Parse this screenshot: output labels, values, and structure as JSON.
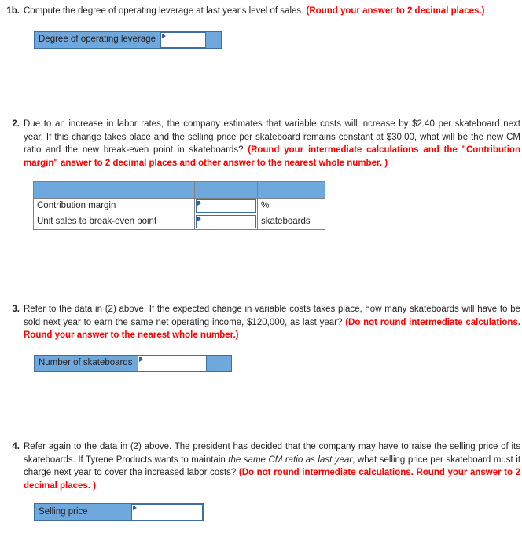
{
  "page": {
    "background_color": "#ffffff",
    "accent_blue": "#6fa8dc",
    "input_border_color": "#3d6fa5",
    "instruction_red": "#ff0000"
  },
  "questions": [
    {
      "number": "1b.",
      "text_before_red": "Compute the degree of operating leverage at last year's level of sales. ",
      "red_instruction": "(Round your answer to 2 decimal places.)"
    },
    {
      "number": "2.",
      "text_before_red": "Due to an increase in labor rates, the company estimates that variable costs will increase by $2.40 per skateboard next year. If this change takes place and the selling price per skateboard remains constant at $30.00, what will be the new CM ratio and the new break-even point in skateboards? ",
      "red_instruction": "(Round  your intermediate calculations and the \"Contribution margin\" answer to 2 decimal places and other answer to the nearest whole number. )"
    },
    {
      "number": "3.",
      "text_before_red": "Refer to the data in (2) above. If the expected change in variable costs takes place, how many skateboards will have to be sold next year to earn the same net operating income, $120,000, as last year? ",
      "red_instruction": "(Do not round intermediate calculations. Round your answer to the nearest whole number.)"
    },
    {
      "number": "4.",
      "text_part1": "Refer again to the data in (2) above. The president has decided that the company may have to raise the selling price of its skateboards. If Tyrene Products wants to maintain ",
      "italic_part": "the same CM ratio as last year",
      "text_part2": ", what selling price per skateboard must it charge next year to cover the increased labor costs? ",
      "red_instruction": "(Do not round intermediate calculations. Round your answer to 2 decimal places. )"
    }
  ],
  "fields": {
    "degree_of_operating_leverage": {
      "label": "Degree of operating leverage",
      "value": ""
    },
    "number_of_skateboards": {
      "label": "Number of skateboards",
      "value": ""
    },
    "selling_price": {
      "label": "Selling price",
      "value": ""
    }
  },
  "answer_table": {
    "header": [
      "",
      "",
      ""
    ],
    "rows": [
      {
        "label": "Contribution margin",
        "value": "",
        "unit": "%"
      },
      {
        "label": "Unit sales to break-even point",
        "value": "",
        "unit": "skateboards"
      }
    ]
  }
}
